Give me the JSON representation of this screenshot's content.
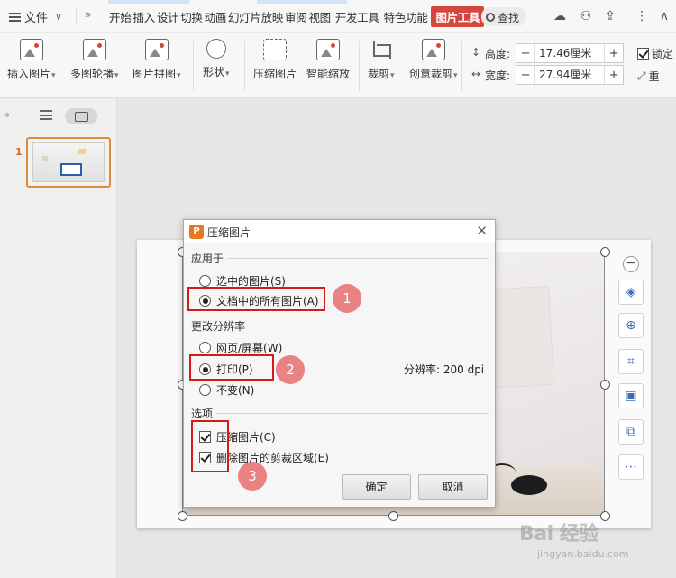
{
  "menubar": {
    "file_label": "文件",
    "tabs": [
      "开始",
      "插入",
      "设计",
      "切换",
      "动画",
      "幻灯片放映",
      "审阅",
      "视图",
      "开发工具",
      "特色功能"
    ],
    "active_tab": "图片工具",
    "search_label": "查找"
  },
  "ribbon": {
    "buttons": [
      {
        "label": "插入图片",
        "icon": "insert-picture-icon",
        "has_dropdown": true
      },
      {
        "label": "多图轮播",
        "icon": "carousel-icon",
        "has_dropdown": true
      },
      {
        "label": "图片拼图",
        "icon": "collage-icon",
        "has_dropdown": true
      },
      {
        "label": "形状",
        "icon": "shape-icon",
        "has_dropdown": true
      },
      {
        "label": "压缩图片",
        "icon": "compress-picture-icon",
        "has_dropdown": false
      },
      {
        "label": "智能缩放",
        "icon": "smart-zoom-icon",
        "has_dropdown": false
      },
      {
        "label": "裁剪",
        "icon": "crop-icon",
        "has_dropdown": true
      },
      {
        "label": "创意裁剪",
        "icon": "creative-crop-icon",
        "has_dropdown": true
      }
    ],
    "height_label": "高度:",
    "height_value": "17.46厘米",
    "width_label": "宽度:",
    "width_value": "27.94厘米",
    "lock_label": "锁定",
    "reset_label": "重"
  },
  "slides": {
    "current_number": "1"
  },
  "dialog": {
    "title": "压缩图片",
    "apply_to_label": "应用于",
    "apply_options": [
      "选中的图片(S)",
      "文档中的所有图片(A)"
    ],
    "apply_selected": 1,
    "resolution_label": "更改分辨率",
    "resolution_options": [
      "网页/屏幕(W)",
      "打印(P)",
      "不变(N)"
    ],
    "resolution_selected": 1,
    "resolution_value": "分辨率:  200 dpi",
    "options_label": "选项",
    "checkboxes": [
      {
        "label": "压缩图片(C)",
        "checked": true
      },
      {
        "label": "删除图片的剪裁区域(E)",
        "checked": true
      }
    ],
    "ok_label": "确定",
    "cancel_label": "取消"
  },
  "annotations": [
    "1",
    "2",
    "3"
  ],
  "watermark": {
    "logo": "Bai 经验",
    "url": "jingyan.baidu.com"
  },
  "colors": {
    "accent": "#d4473f",
    "annotation_box": "#d11c1c",
    "annotation_badge": "#e98282",
    "dialog_logo": "#e87722"
  }
}
